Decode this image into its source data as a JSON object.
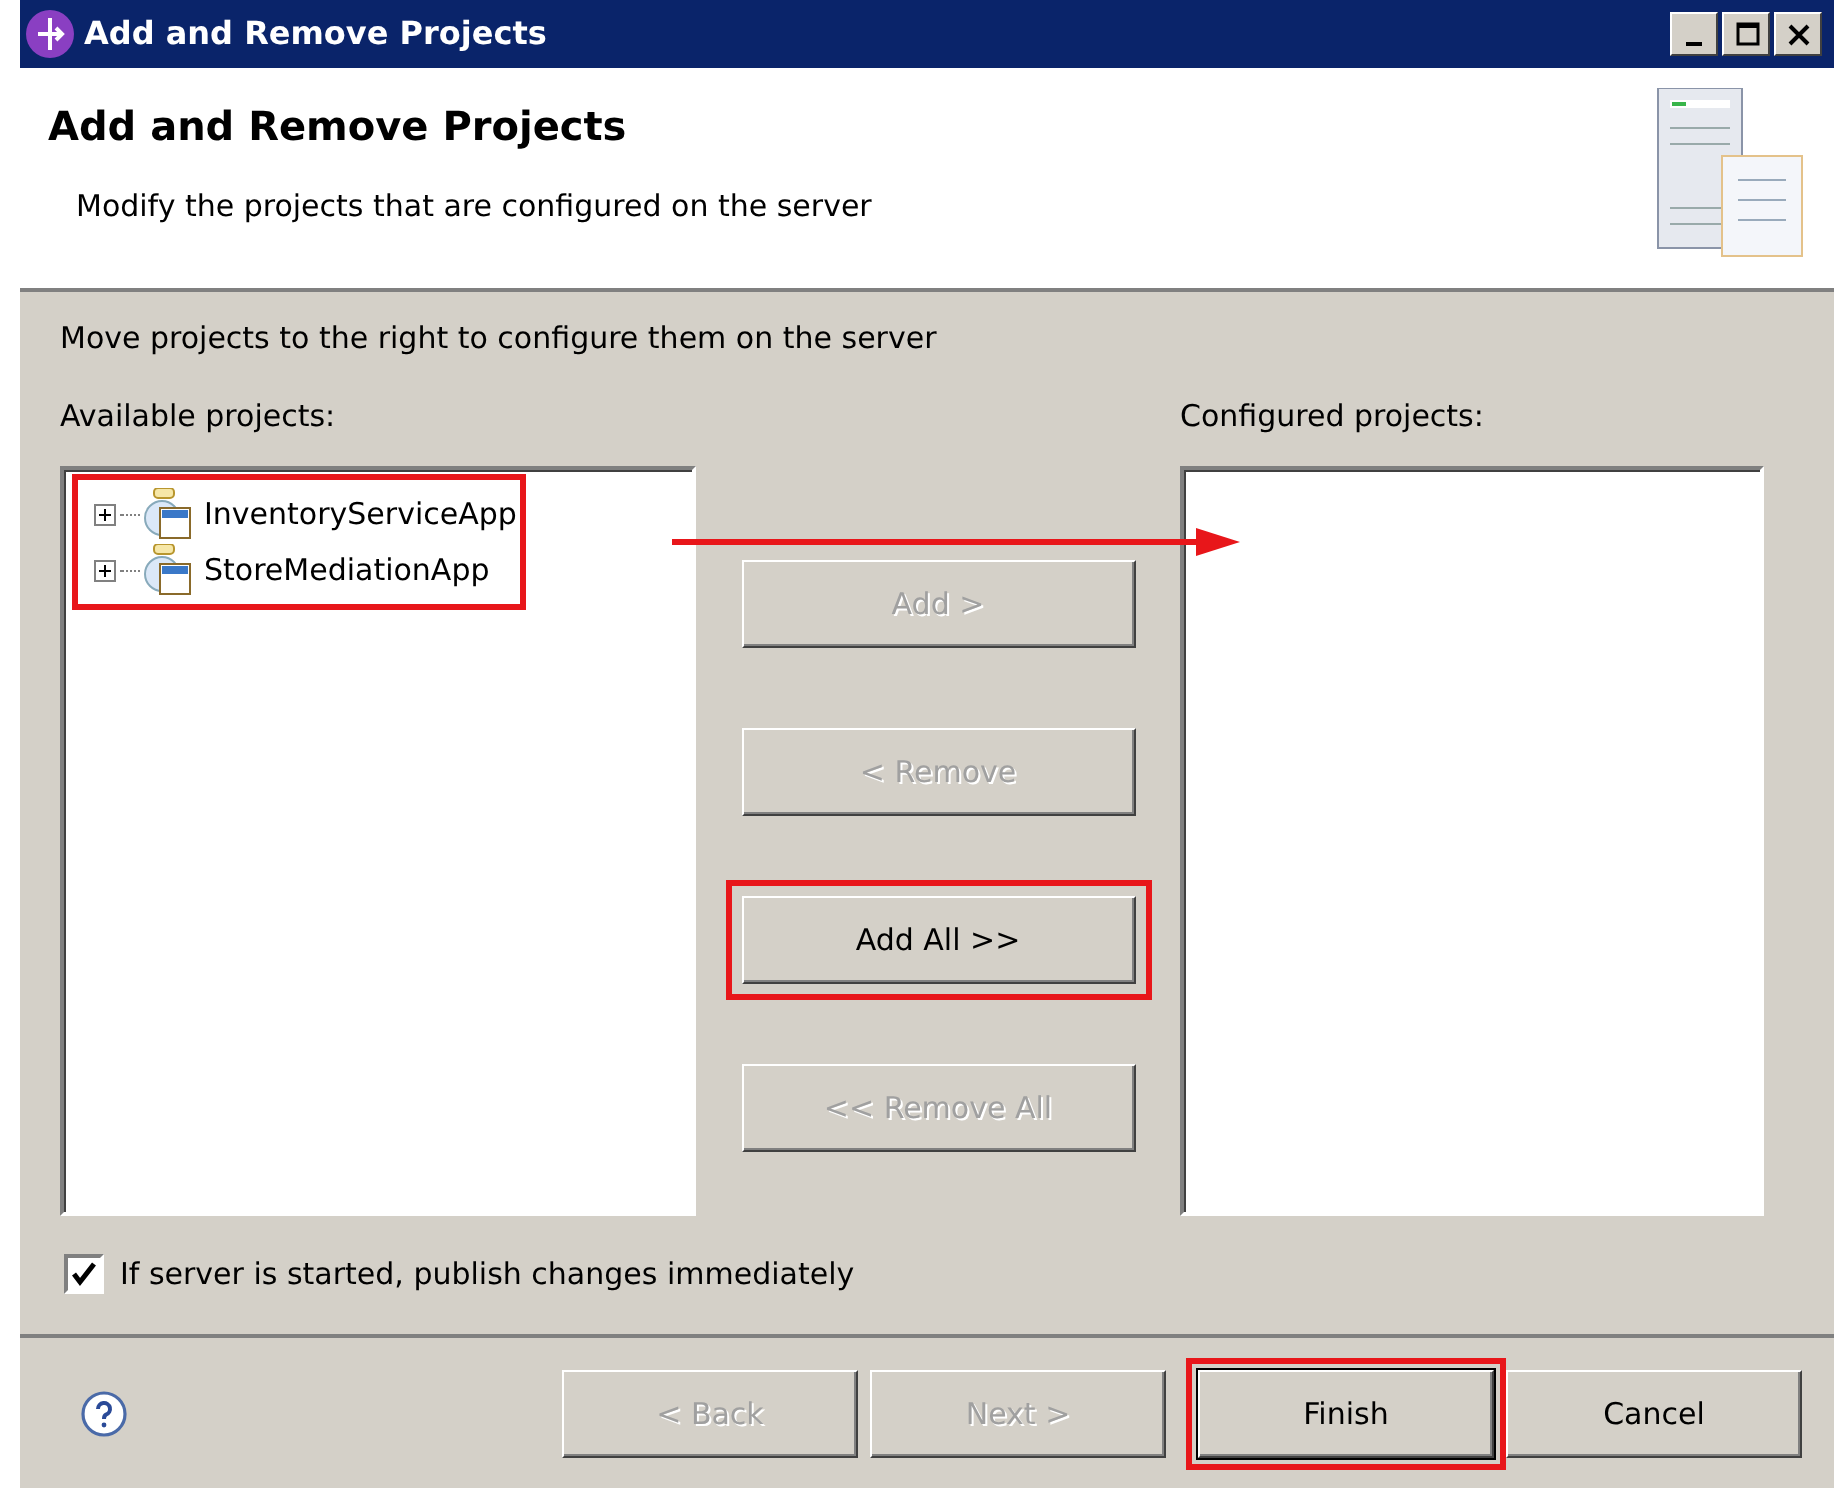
{
  "window": {
    "title": "Add and Remove Projects"
  },
  "header": {
    "title": "Add and Remove Projects",
    "subtitle": "Modify the projects that are configured on the server"
  },
  "instruction": "Move projects to the right to configure them on the server",
  "available": {
    "label": "Available projects:",
    "highlighted": true,
    "items": [
      {
        "label": "InventoryServiceApp",
        "expanded": false
      },
      {
        "label": "StoreMediationApp",
        "expanded": false
      }
    ]
  },
  "configured": {
    "label": "Configured projects:"
  },
  "move_arrow": true,
  "move_buttons": [
    {
      "label": "Add >",
      "disabled": true,
      "highlighted": false
    },
    {
      "label": "< Remove",
      "disabled": true,
      "highlighted": false
    },
    {
      "label": "Add All >>",
      "disabled": false,
      "highlighted": true
    },
    {
      "label": "<< Remove All",
      "disabled": true,
      "highlighted": false
    }
  ],
  "publish_option": {
    "label": "If server is started, publish changes immediately",
    "checked": true
  },
  "footer_buttons": [
    {
      "label": "< Back",
      "disabled": true,
      "highlighted": false
    },
    {
      "label": "Next >",
      "disabled": true,
      "highlighted": false
    },
    {
      "label": "Finish",
      "disabled": false,
      "highlighted": true
    },
    {
      "label": "Cancel",
      "disabled": false,
      "highlighted": false
    }
  ]
}
